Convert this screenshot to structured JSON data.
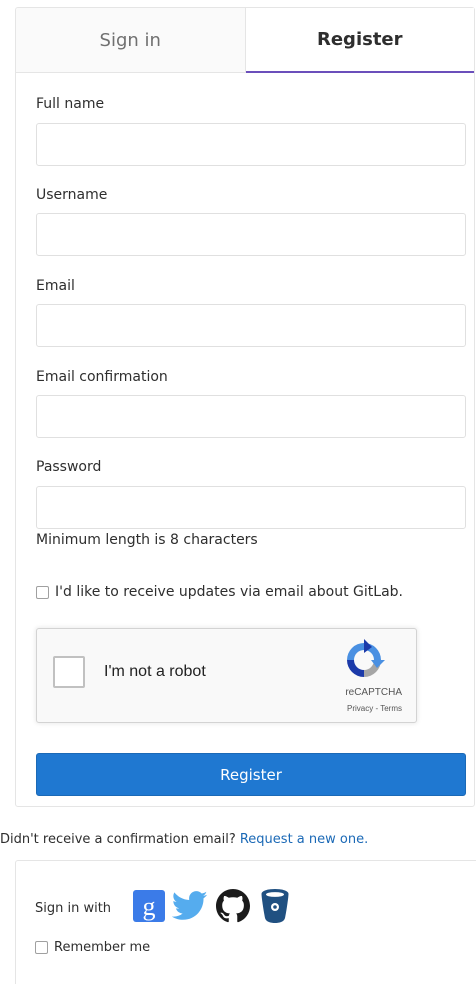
{
  "tabs": {
    "signin": "Sign in",
    "register": "Register"
  },
  "form": {
    "fields": [
      {
        "label": "Full name",
        "value": ""
      },
      {
        "label": "Username",
        "value": ""
      },
      {
        "label": "Email",
        "value": ""
      },
      {
        "label": "Email confirmation",
        "value": ""
      },
      {
        "label": "Password",
        "value": ""
      }
    ],
    "password_hint": "Minimum length is 8 characters",
    "updates_checkbox_label": "I'd like to receive updates via email about GitLab.",
    "recaptcha": {
      "label": "I'm not a robot",
      "brand": "reCAPTCHA",
      "links": "Privacy - Terms"
    },
    "register_button": "Register"
  },
  "confirmation": {
    "text": "Didn't receive a confirmation email? ",
    "link": "Request a new one."
  },
  "omniauth": {
    "label": "Sign in with",
    "providers": [
      "google-icon",
      "twitter-icon",
      "github-icon",
      "bitbucket-icon"
    ],
    "remember_label": "Remember me"
  },
  "colors": {
    "accent": "#6b4fbb",
    "primary_button": "#1f78d1",
    "link": "#1b69b6"
  }
}
